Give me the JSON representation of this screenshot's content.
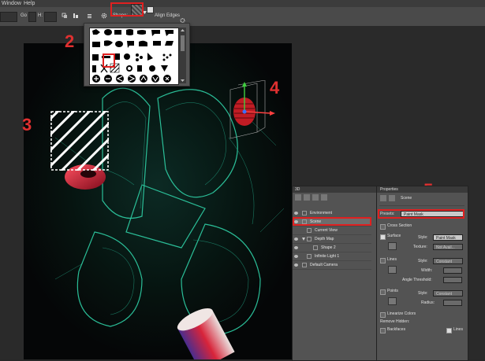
{
  "menubar": {
    "items": [
      "Window",
      "Help"
    ]
  },
  "options": {
    "field1": "",
    "go_label": "Go",
    "h_label": "H:",
    "field2": "",
    "shape_label": "Shape:",
    "align_edges_label": "Align Edges"
  },
  "annotations": [
    "2",
    "3",
    "4",
    "5"
  ],
  "panel_3d": {
    "title": "3D",
    "layers": [
      {
        "name": "Environment"
      },
      {
        "name": "Scene"
      },
      {
        "name": "Current View"
      },
      {
        "name": "Depth Map"
      },
      {
        "name": "Shape 2"
      },
      {
        "name": "Infinite Light 1"
      },
      {
        "name": "Default Camera"
      }
    ]
  },
  "panel_props": {
    "title": "Properties",
    "header": "Scene",
    "presets_label": "Presets:",
    "presets_value": "Paint Mask",
    "cross_section": "Cross Section",
    "surface": "Surface",
    "style_label": "Style:",
    "surface_style": "Paint Mask",
    "texture_label": "Texture:",
    "texture_value": "Not Avail...",
    "lines": "Lines",
    "lines_style_label": "Style:",
    "lines_style": "Constant",
    "width_label": "Width:",
    "angle_label": "Angle Threshold:",
    "points": "Points",
    "points_style_label": "Style:",
    "points_style": "Constant",
    "radius_label": "Radius:",
    "linearize": "Linearize Colors",
    "remove_hidden": "Remove Hidden:",
    "backfaces": "Backfaces",
    "lines_chk": "Lines"
  },
  "colors": {
    "accent_red": "#e02020",
    "glow": "#2fd0a6"
  }
}
